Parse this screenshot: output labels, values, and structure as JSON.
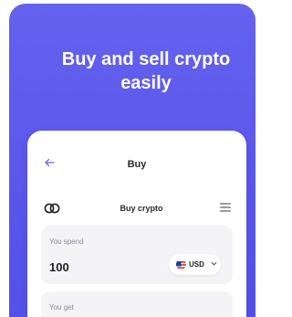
{
  "hero": {
    "headline_line1": "Buy and sell crypto",
    "headline_line2": "easily"
  },
  "screen": {
    "back_icon": "back-arrow-icon",
    "title": "Buy",
    "section_title": "Buy crypto",
    "coin_icon": "coins-icon",
    "menu_icon": "menu-icon"
  },
  "spend": {
    "label": "You spend",
    "amount": "100",
    "currency": "USD",
    "flag_icon": "us-flag-icon"
  },
  "get": {
    "label": "You get"
  },
  "colors": {
    "brand": "#5b57eb",
    "card_bg": "#f4f4f7",
    "accent_text": "#6a66ee"
  }
}
